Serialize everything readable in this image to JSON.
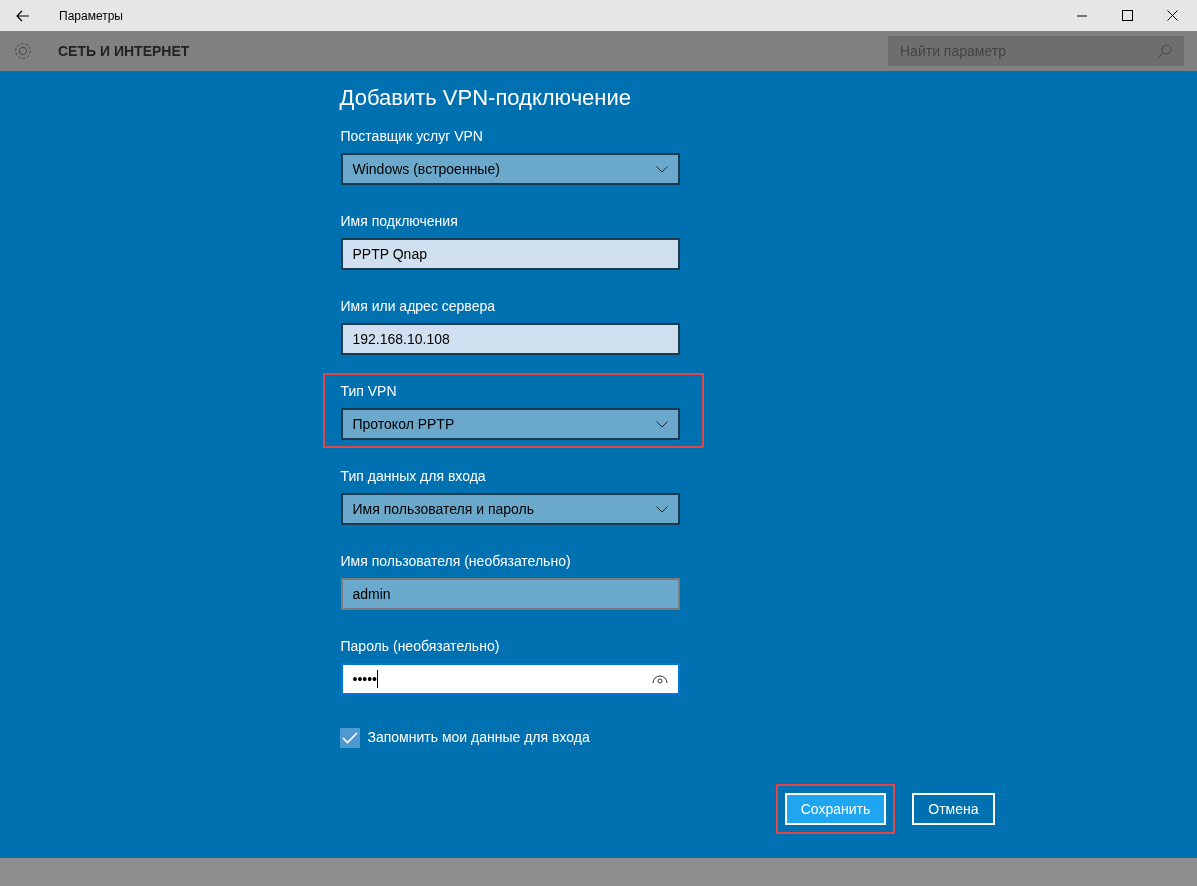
{
  "window": {
    "title": "Параметры"
  },
  "header": {
    "section": "СЕТЬ И ИНТЕРНЕТ",
    "search": {
      "placeholder": "Найти параметр"
    }
  },
  "dialog": {
    "title": "Добавить VPN-подключение",
    "fields": [
      {
        "kind": "dropdown",
        "label": "Поставщик услуг VPN",
        "value": "Windows (встроенные)",
        "highlighted": false,
        "hovered": false,
        "focused": false
      },
      {
        "kind": "text",
        "label": "Имя подключения",
        "value": "PPTP Qnap",
        "highlighted": false,
        "hovered": false,
        "focused": false
      },
      {
        "kind": "text",
        "label": "Имя или адрес сервера",
        "value": "192.168.10.108",
        "highlighted": false,
        "hovered": false,
        "focused": false
      },
      {
        "kind": "dropdown",
        "label": "Тип VPN",
        "value": "Протокол PPTP",
        "highlighted": true,
        "hovered": false,
        "focused": false
      },
      {
        "kind": "dropdown",
        "label": "Тип данных для входа",
        "value": "Имя пользователя и пароль",
        "highlighted": false,
        "hovered": false,
        "focused": false
      },
      {
        "kind": "text",
        "label": "Имя пользователя (необязательно)",
        "value": "admin",
        "highlighted": false,
        "hovered": true,
        "focused": false
      },
      {
        "kind": "password",
        "label": "Пароль (необязательно)",
        "value": "•••••",
        "highlighted": false,
        "hovered": false,
        "focused": true
      }
    ],
    "remember": {
      "label": "Запомнить мои данные для входа",
      "checked": true
    },
    "buttons": [
      {
        "kind": "primary",
        "label": "Сохранить",
        "highlighted": true
      },
      {
        "kind": "secondary",
        "label": "Отмена",
        "highlighted": false
      }
    ]
  }
}
